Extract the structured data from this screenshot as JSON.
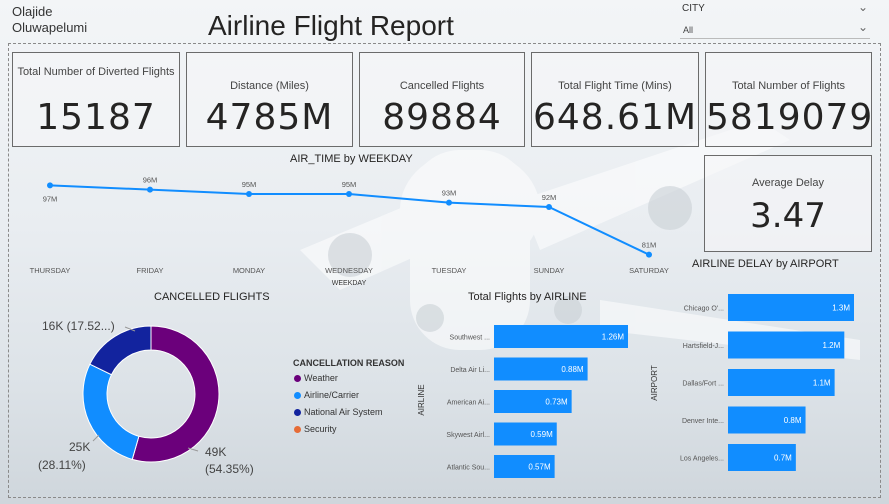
{
  "header": {
    "author": [
      "Olajide",
      "Oluwapelumi"
    ],
    "title": "Airline Flight Report",
    "city_filter": {
      "label": "CITY",
      "value": "All"
    }
  },
  "cards": [
    {
      "label": "Total Number of Diverted Flights",
      "value": "15187"
    },
    {
      "label": "Distance (Miles)",
      "value": "4785M"
    },
    {
      "label": "Cancelled Flights",
      "value": "89884"
    },
    {
      "label": "Total Flight Time (Mins)",
      "value": "648.61M"
    },
    {
      "label": "Total Number of Flights",
      "value": "5819079"
    }
  ],
  "average_delay": {
    "label": "Average Delay",
    "value": "3.47"
  },
  "legend": {
    "title": "CANCELLATION REASON",
    "items": [
      "Weather",
      "Airline/Carrier",
      "National Air System",
      "Security"
    ]
  },
  "colors": {
    "line": "#118DFF",
    "bar": "#118DFF",
    "weather": "#6B007B",
    "airline_carrier": "#118DFF",
    "national_air_system": "#12239E",
    "security": "#E66C37"
  },
  "chart_data": [
    {
      "type": "line",
      "title": "AIR_TIME by WEEKDAY",
      "xlabel": "WEEKDAY",
      "categories": [
        "THURSDAY",
        "FRIDAY",
        "MONDAY",
        "WEDNESDAY",
        "TUESDAY",
        "SUNDAY",
        "SATURDAY"
      ],
      "values": [
        97,
        96,
        95,
        95,
        93,
        92,
        81
      ],
      "data_labels": [
        "97M",
        "96M",
        "95M",
        "95M",
        "93M",
        "92M",
        "81M"
      ],
      "unit": "M"
    },
    {
      "type": "pie",
      "title": "CANCELLED FLIGHTS",
      "donut": true,
      "slices": [
        {
          "name": "Weather",
          "value": 49,
          "label": "49K",
          "pct": "(54.35%)"
        },
        {
          "name": "Airline/Carrier",
          "value": 25,
          "label": "25K",
          "pct": "(28.11%)"
        },
        {
          "name": "National Air System",
          "value": 16,
          "label": "16K (17.52...)",
          "pct": ""
        },
        {
          "name": "Security",
          "value": 0,
          "label": "",
          "pct": ""
        }
      ]
    },
    {
      "type": "bar",
      "orientation": "horizontal",
      "title": "Total Flights by AIRLINE",
      "ylabel": "AIRLINE",
      "categories": [
        "Southwest ...",
        "Delta Air Li...",
        "American Ai...",
        "Skywest Airl...",
        "Atlantic Sou..."
      ],
      "values": [
        1.26,
        0.88,
        0.73,
        0.59,
        0.57
      ],
      "data_labels": [
        "1.26M",
        "0.88M",
        "0.73M",
        "0.59M",
        "0.57M"
      ],
      "unit": "M"
    },
    {
      "type": "bar",
      "orientation": "horizontal",
      "title": "AIRLINE DELAY by AIRPORT",
      "ylabel": "AIRPORT",
      "categories": [
        "Chicago O'...",
        "Hartsfield-J...",
        "Dallas/Fort ...",
        "Denver Inte...",
        "Los Angeles..."
      ],
      "values": [
        1.3,
        1.2,
        1.1,
        0.8,
        0.7
      ],
      "data_labels": [
        "1.3M",
        "1.2M",
        "1.1M",
        "0.8M",
        "0.7M"
      ],
      "unit": "M"
    }
  ]
}
